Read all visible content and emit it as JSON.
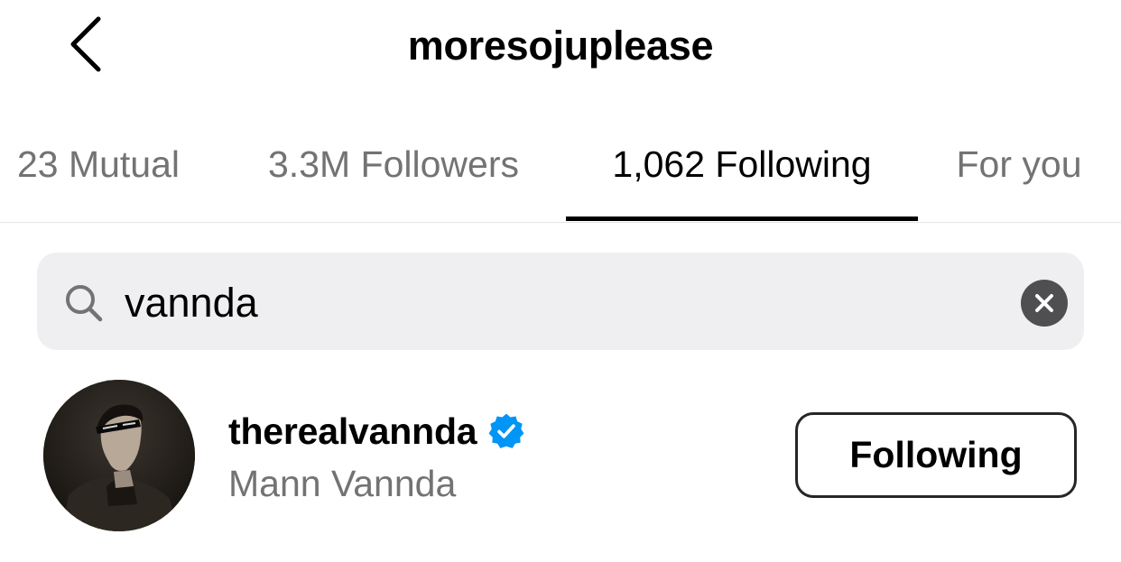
{
  "header": {
    "title": "moresojuplease",
    "back_icon": "chevron-left-icon"
  },
  "tabs": [
    {
      "label": "23 Mutual",
      "active": false
    },
    {
      "label": "3.3M Followers",
      "active": false
    },
    {
      "label": "1,062 Following",
      "active": true
    },
    {
      "label": "For you",
      "active": false
    }
  ],
  "search": {
    "icon": "search-icon",
    "value": "vannda",
    "clear_icon": "clear-icon"
  },
  "results": [
    {
      "username": "therealvannda",
      "verified": true,
      "full_name": "Mann Vannda",
      "button_label": "Following",
      "avatar_icon": "profile-photo"
    }
  ],
  "colors": {
    "text_primary": "#000000",
    "text_secondary": "#737373",
    "search_background": "#efeff1",
    "verified_badge": "#0095f6",
    "clear_button": "#4f4f52",
    "divider": "#e5e5e5"
  }
}
